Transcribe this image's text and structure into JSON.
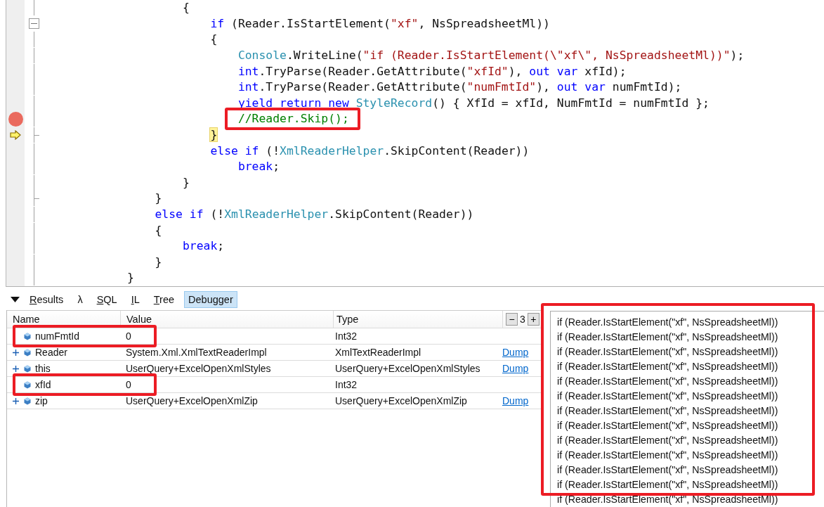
{
  "editor": {
    "lines": [
      {
        "children": [
          {
            "children": [
              {
                "kind": "plain",
                "breakpoint": false,
                "current": false,
                "annotated": false,
                "tokens": [
                  {
                    "kind": "plain",
                    "text": "{"
                  }
                ]
              },
              {
                "children": [
                  {
                    "kind": "opener",
                    "breakpoint": false,
                    "current": false,
                    "annotated": false,
                    "tokens": [
                      {
                        "kind": "keyword",
                        "text": "if"
                      },
                      {
                        "kind": "plain",
                        "text": " (Reader.IsStartElement("
                      },
                      {
                        "kind": "string",
                        "text": "\"xf\""
                      },
                      {
                        "kind": "plain",
                        "text": ", NsSpreadsheetMl))"
                      }
                    ]
                  },
                  {
                    "kind": "plain",
                    "breakpoint": false,
                    "current": false,
                    "annotated": false,
                    "tokens": [
                      {
                        "kind": "plain",
                        "text": "{"
                      }
                    ]
                  },
                  {
                    "children": [
                      {
                        "kind": "plain",
                        "breakpoint": false,
                        "current": false,
                        "annotated": false,
                        "tokens": [
                          {
                            "kind": "type",
                            "text": "Console"
                          },
                          {
                            "kind": "plain",
                            "text": ".WriteLine("
                          },
                          {
                            "kind": "string",
                            "text": "\"if (Reader.IsStartElement(\\\"xf\\\", NsSpreadsheetMl))\""
                          },
                          {
                            "kind": "plain",
                            "text": ");"
                          }
                        ]
                      },
                      {
                        "kind": "plain",
                        "breakpoint": false,
                        "current": false,
                        "annotated": false,
                        "tokens": [
                          {
                            "kind": "keyword",
                            "text": "int"
                          },
                          {
                            "kind": "plain",
                            "text": ".TryParse(Reader.GetAttribute("
                          },
                          {
                            "kind": "string",
                            "text": "\"xfId\""
                          },
                          {
                            "kind": "plain",
                            "text": "), "
                          },
                          {
                            "kind": "keyword",
                            "text": "out var"
                          },
                          {
                            "kind": "plain",
                            "text": " xfId);"
                          }
                        ]
                      },
                      {
                        "kind": "plain",
                        "breakpoint": false,
                        "current": false,
                        "annotated": false,
                        "tokens": [
                          {
                            "kind": "keyword",
                            "text": "int"
                          },
                          {
                            "kind": "plain",
                            "text": ".TryParse(Reader.GetAttribute("
                          },
                          {
                            "kind": "string",
                            "text": "\"numFmtId\""
                          },
                          {
                            "kind": "plain",
                            "text": "), "
                          },
                          {
                            "kind": "keyword",
                            "text": "out var"
                          },
                          {
                            "kind": "plain",
                            "text": " numFmtId);"
                          }
                        ]
                      },
                      {
                        "kind": "plain",
                        "breakpoint": false,
                        "current": false,
                        "annotated": false,
                        "tokens": [
                          {
                            "kind": "keyword",
                            "text": "yield return new"
                          },
                          {
                            "kind": "type",
                            "text": " StyleRecord"
                          },
                          {
                            "kind": "plain",
                            "text": "() { XfId = xfId, NumFmtId = numFmtId };"
                          }
                        ]
                      },
                      {
                        "kind": "plain",
                        "breakpoint": true,
                        "current": false,
                        "annotated": true,
                        "tokens": [
                          {
                            "kind": "comment",
                            "text": "//Reader.Skip();"
                          }
                        ]
                      }
                    ]
                  },
                  {
                    "kind": "closer",
                    "breakpoint": false,
                    "current": true,
                    "annotated": false,
                    "tokens": [
                      {
                        "kind": "plain",
                        "text": "}"
                      }
                    ]
                  },
                  {
                    "kind": "plain",
                    "breakpoint": false,
                    "current": false,
                    "annotated": false,
                    "tokens": [
                      {
                        "kind": "keyword",
                        "text": "else if"
                      },
                      {
                        "kind": "plain",
                        "text": " (!"
                      },
                      {
                        "kind": "type",
                        "text": "XmlReaderHelper"
                      },
                      {
                        "kind": "plain",
                        "text": ".SkipContent(Reader))"
                      }
                    ]
                  },
                  {
                    "children": [
                      {
                        "kind": "plain",
                        "breakpoint": false,
                        "current": false,
                        "annotated": false,
                        "tokens": [
                          {
                            "kind": "keyword",
                            "text": "break"
                          },
                          {
                            "kind": "plain",
                            "text": ";"
                          }
                        ]
                      }
                    ]
                  }
                ]
              },
              {
                "kind": "plain",
                "breakpoint": false,
                "current": false,
                "annotated": false,
                "tokens": [
                  {
                    "kind": "plain",
                    "text": "}"
                  }
                ]
              }
            ]
          },
          {
            "kind": "closer",
            "breakpoint": false,
            "current": false,
            "annotated": false,
            "tokens": [
              {
                "kind": "plain",
                "text": "}"
              }
            ]
          },
          {
            "kind": "plain",
            "breakpoint": false,
            "current": false,
            "annotated": false,
            "tokens": [
              {
                "kind": "keyword",
                "text": "else if"
              },
              {
                "kind": "plain",
                "text": " (!"
              },
              {
                "kind": "type",
                "text": "XmlReaderHelper"
              },
              {
                "kind": "plain",
                "text": ".SkipContent(Reader))"
              }
            ]
          },
          {
            "kind": "plain",
            "breakpoint": false,
            "current": false,
            "annotated": false,
            "tokens": [
              {
                "kind": "plain",
                "text": "{"
              }
            ]
          },
          {
            "children": [
              {
                "kind": "plain",
                "breakpoint": false,
                "current": false,
                "annotated": false,
                "tokens": [
                  {
                    "kind": "keyword",
                    "text": "break"
                  },
                  {
                    "kind": "plain",
                    "text": ";"
                  }
                ]
              }
            ]
          },
          {
            "kind": "plain",
            "breakpoint": false,
            "current": false,
            "annotated": false,
            "tokens": [
              {
                "kind": "plain",
                "text": "}"
              }
            ]
          }
        ]
      },
      {
        "kind": "plain",
        "breakpoint": false,
        "current": false,
        "annotated": false,
        "tokens": [
          {
            "kind": "plain",
            "text": "}"
          }
        ]
      }
    ]
  },
  "tabs": [
    {
      "access_key": "R",
      "label": "esults",
      "selected": false
    },
    {
      "label": "λ",
      "selected": false
    },
    {
      "access_key": "S",
      "label": "QL",
      "selected": false
    },
    {
      "access_key": "I",
      "label": "L",
      "selected": false
    },
    {
      "access_key": "T",
      "label": "ree",
      "selected": false
    },
    {
      "label": "Debugger",
      "selected": true
    }
  ],
  "locals": {
    "columns": [
      "Name",
      "Value",
      "Type"
    ],
    "depth_controls": {
      "decrease": "−",
      "value": "3",
      "increase": "+"
    },
    "rows": [
      {
        "expandable": false,
        "annotated": true,
        "name": "numFmtId",
        "value": "0",
        "type": "Int32"
      },
      {
        "expandable": true,
        "annotated": false,
        "name": "Reader",
        "value": "System.Xml.XmlTextReaderImpl",
        "type": "XmlTextReaderImpl",
        "link": "Dump"
      },
      {
        "expandable": true,
        "annotated": false,
        "name": "this",
        "value": "UserQuery+ExcelOpenXmlStyles",
        "type": "UserQuery+ExcelOpenXmlStyles",
        "link": "Dump"
      },
      {
        "expandable": false,
        "annotated": true,
        "name": "xfId",
        "value": "0",
        "type": "Int32"
      },
      {
        "expandable": true,
        "annotated": false,
        "name": "zip",
        "value": "UserQuery+ExcelOpenXmlZip",
        "type": "UserQuery+ExcelOpenXmlZip",
        "link": "Dump"
      }
    ]
  },
  "output": {
    "annotated": true,
    "lines": [
      "if (Reader.IsStartElement(\"xf\", NsSpreadsheetMl))",
      "if (Reader.IsStartElement(\"xf\", NsSpreadsheetMl))",
      "if (Reader.IsStartElement(\"xf\", NsSpreadsheetMl))",
      "if (Reader.IsStartElement(\"xf\", NsSpreadsheetMl))",
      "if (Reader.IsStartElement(\"xf\", NsSpreadsheetMl))",
      "if (Reader.IsStartElement(\"xf\", NsSpreadsheetMl))",
      "if (Reader.IsStartElement(\"xf\", NsSpreadsheetMl))",
      "if (Reader.IsStartElement(\"xf\", NsSpreadsheetMl))",
      "if (Reader.IsStartElement(\"xf\", NsSpreadsheetMl))",
      "if (Reader.IsStartElement(\"xf\", NsSpreadsheetMl))",
      "if (Reader.IsStartElement(\"xf\", NsSpreadsheetMl))",
      "if (Reader.IsStartElement(\"xf\", NsSpreadsheetMl))",
      "if (Reader.IsStartElement(\"xf\", NsSpreadsheetMl))"
    ]
  }
}
